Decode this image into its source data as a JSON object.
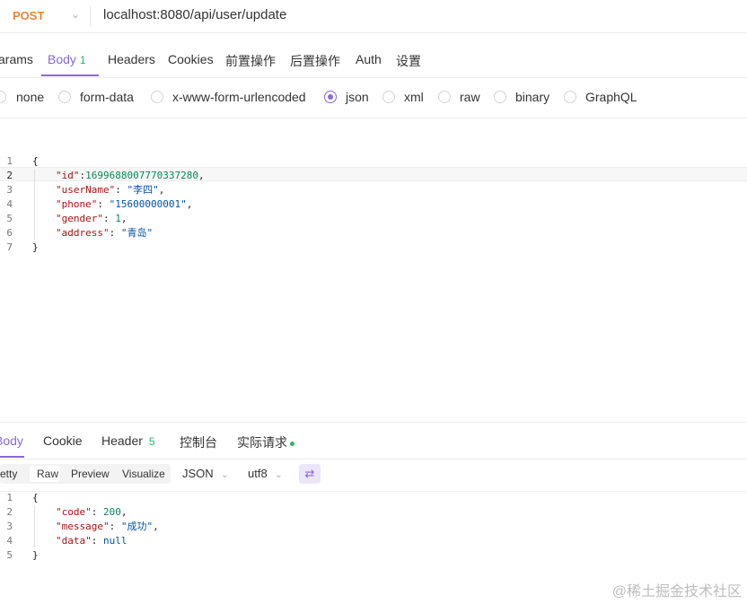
{
  "request": {
    "method": "POST",
    "url": "localhost:8080/api/user/update"
  },
  "request_tabs": [
    {
      "label": "Params",
      "shown": "arams"
    },
    {
      "label": "Body",
      "count": "1"
    },
    {
      "label": "Headers"
    },
    {
      "label": "Cookies"
    },
    {
      "label": "前置操作"
    },
    {
      "label": "后置操作"
    },
    {
      "label": "Auth"
    },
    {
      "label": "设置"
    }
  ],
  "body_types": [
    {
      "label": "none",
      "selected": false
    },
    {
      "label": "form-data",
      "selected": false
    },
    {
      "label": "x-www-form-urlencoded",
      "selected": false
    },
    {
      "label": "json",
      "selected": true
    },
    {
      "label": "xml",
      "selected": false
    },
    {
      "label": "raw",
      "selected": false
    },
    {
      "label": "binary",
      "selected": false
    },
    {
      "label": "GraphQL",
      "selected": false
    }
  ],
  "request_body": {
    "line_numbers": [
      "1",
      "2",
      "3",
      "4",
      "5",
      "6",
      "7"
    ],
    "active_line": 2,
    "open": "{",
    "close": "}",
    "fields": [
      {
        "key": "\"id\"",
        "sep": ":",
        "value": "1699688007770337280",
        "tail": ","
      },
      {
        "key": "\"userName\"",
        "sep": ": ",
        "value": "\"李四\"",
        "tail": ","
      },
      {
        "key": "\"phone\"",
        "sep": ": ",
        "value": "\"15600000001\"",
        "tail": ","
      },
      {
        "key": "\"gender\"",
        "sep": ": ",
        "value": "1",
        "tail": ","
      },
      {
        "key": "\"address\"",
        "sep": ": ",
        "value": "\"青岛\"",
        "tail": ""
      }
    ]
  },
  "response_tabs": [
    {
      "label": "Body",
      "shown": "Body"
    },
    {
      "label": "Cookie"
    },
    {
      "label": "Header",
      "count": "5"
    },
    {
      "label": "控制台"
    },
    {
      "label": "实际请求"
    }
  ],
  "response_toolbar": {
    "views": [
      "Pretty",
      "Raw",
      "Preview",
      "Visualize"
    ],
    "pretty_shown": "retty",
    "active_view": "Raw",
    "format": "JSON",
    "encoding": "utf8"
  },
  "response_body": {
    "line_numbers": [
      "1",
      "2",
      "3",
      "4",
      "5"
    ],
    "open": "{",
    "close": "}",
    "fields": [
      {
        "key": "\"code\"",
        "sep": ": ",
        "value": "200",
        "tail": ","
      },
      {
        "key": "\"message\"",
        "sep": ": ",
        "value": "\"成功\"",
        "tail": ","
      },
      {
        "key": "\"data\"",
        "sep": ": ",
        "value": "null",
        "tail": ""
      }
    ]
  },
  "watermark": "@稀土掘金技术社区",
  "colors": {
    "accent": "#8a68d8",
    "method": "#e8853a",
    "count": "#2fb36c"
  }
}
